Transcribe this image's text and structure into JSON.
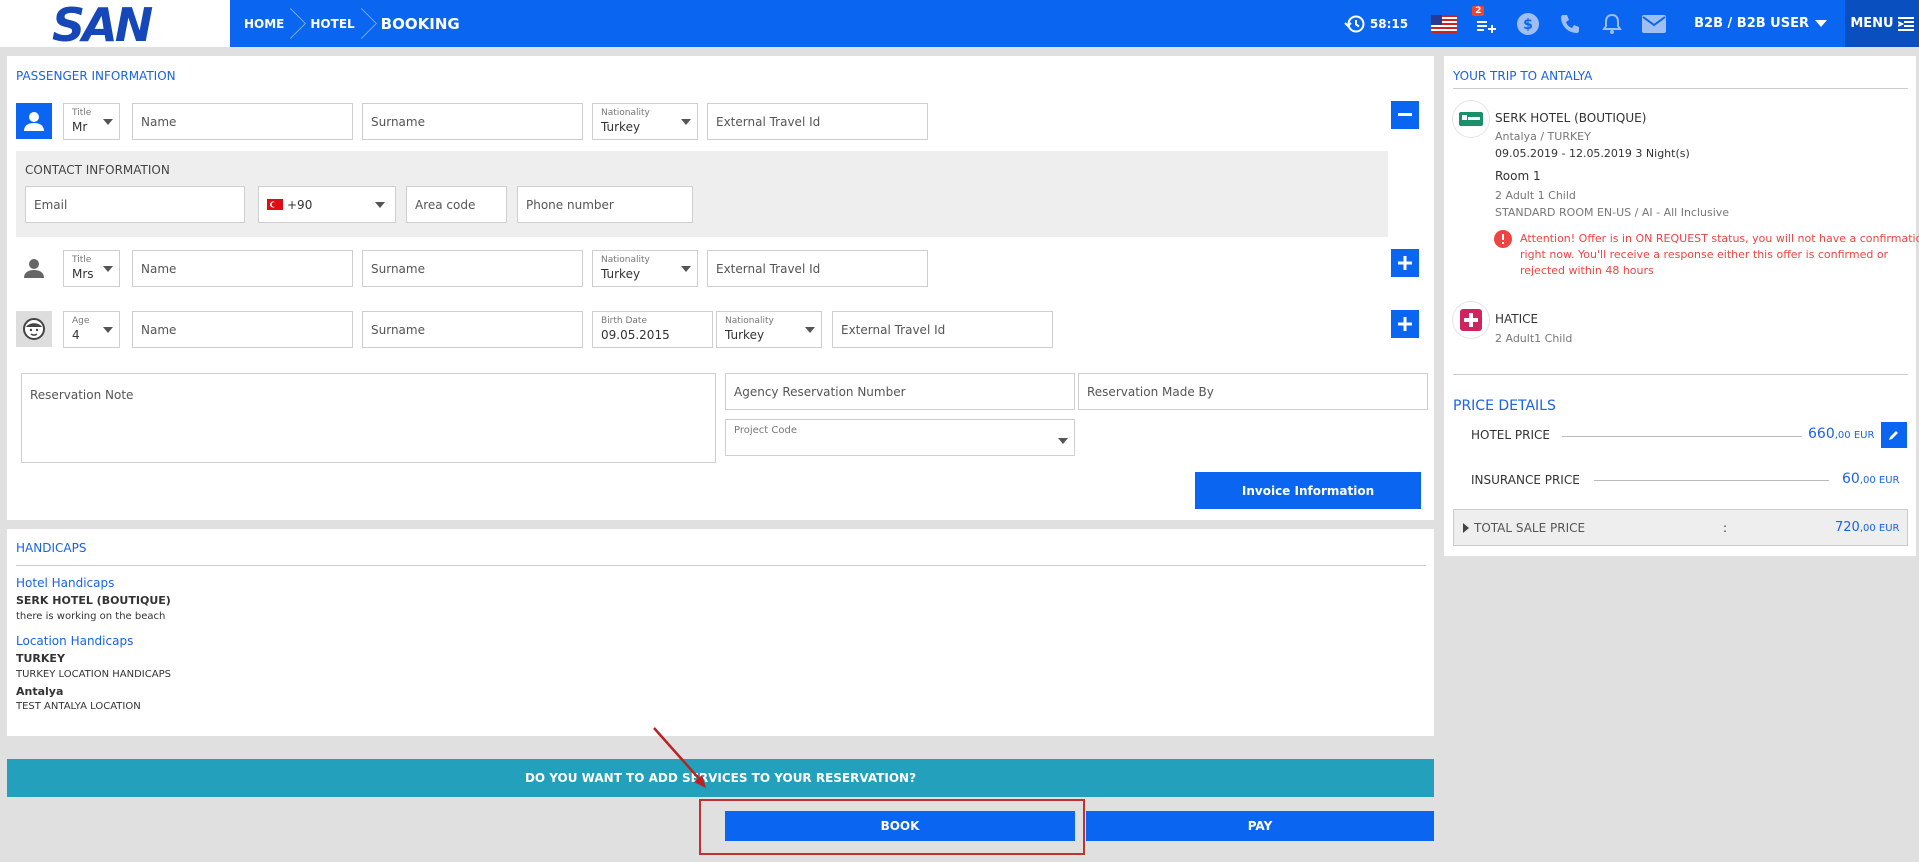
{
  "header": {
    "logo": "SAN",
    "breadcrumbs": [
      "HOME",
      "HOTEL",
      "BOOKING"
    ],
    "timer": "58:15",
    "cart_badge": "2",
    "user": "B2B / B2B USER",
    "menu": "MENU",
    "colors": {
      "bar": "#0a66f0",
      "menu_bg": "#0a4fc0"
    }
  },
  "passenger": {
    "title": "PASSENGER INFORMATION",
    "row1": {
      "title_label": "Title",
      "title_value": "Mr",
      "name": "Name",
      "surname": "Surname",
      "nationality_label": "Nationality",
      "nationality_value": "Turkey",
      "external": "External Travel Id"
    },
    "contact": {
      "title": "CONTACT INFORMATION",
      "email": "Email",
      "country_code": "+90",
      "area_code": "Area code",
      "phone": "Phone number"
    },
    "row2": {
      "title_label": "Title",
      "title_value": "Mrs",
      "name": "Name",
      "surname": "Surname",
      "nationality_label": "Nationality",
      "nationality_value": "Turkey",
      "external": "External Travel Id"
    },
    "row3": {
      "age_label": "Age",
      "age_value": "4",
      "name": "Name",
      "surname": "Surname",
      "birth_label": "Birth Date",
      "birth_value": "09.05.2015",
      "nationality_label": "Nationality",
      "nationality_value": "Turkey",
      "external": "External Travel Id"
    },
    "reservation_note": "Reservation Note",
    "agency_number": "Agency Reservation Number",
    "made_by": "Reservation Made By",
    "project_code": "Project Code",
    "invoice_button": "Invoice Information"
  },
  "handicaps": {
    "title": "HANDICAPS",
    "hotel_heading": "Hotel Handicaps",
    "hotel_name": "SERK HOTEL (BOUTIQUE)",
    "hotel_note": "there is working on the beach",
    "location_heading": "Location Handicaps",
    "loc1": "TURKEY",
    "loc1_note": "TURKEY LOCATION HANDICAPS",
    "loc2": "Antalya",
    "loc2_note": "TEST ANTALYA LOCATION"
  },
  "add_services": "DO YOU WANT TO ADD SERVICES TO YOUR RESERVATION?",
  "actions": {
    "book": "BOOK",
    "pay": "PAY"
  },
  "trip": {
    "title": "YOUR TRIP TO ANTALYA",
    "hotel": "SERK HOTEL (BOUTIQUE)",
    "location": "Antalya / TURKEY",
    "dates": "09.05.2019 - 12.05.2019 3 Night(s)",
    "room": "Room 1",
    "pax": "2 Adult 1 Child",
    "room_type": "STANDARD ROOM EN-US / AI - All Inclusive",
    "warning": [
      "Attention! Offer is in ON REQUEST status, you will not have a confirmation",
      "right now. You'll receive a response either this offer is confirmed or",
      "rejected within 48 hours"
    ],
    "insurance": "HATICE",
    "insurance_pax": "2 Adult1 Child"
  },
  "price": {
    "title": "PRICE DETAILS",
    "hotel_label": "HOTEL PRICE",
    "hotel_amount": "660",
    "hotel_dec": ",00 EUR",
    "insurance_label": "INSURANCE PRICE",
    "insurance_amount": "60",
    "insurance_dec": ",00 EUR",
    "total_label": "TOTAL SALE PRICE",
    "total_sep": ":",
    "total_amount": "720",
    "total_dec": ",00 EUR"
  }
}
